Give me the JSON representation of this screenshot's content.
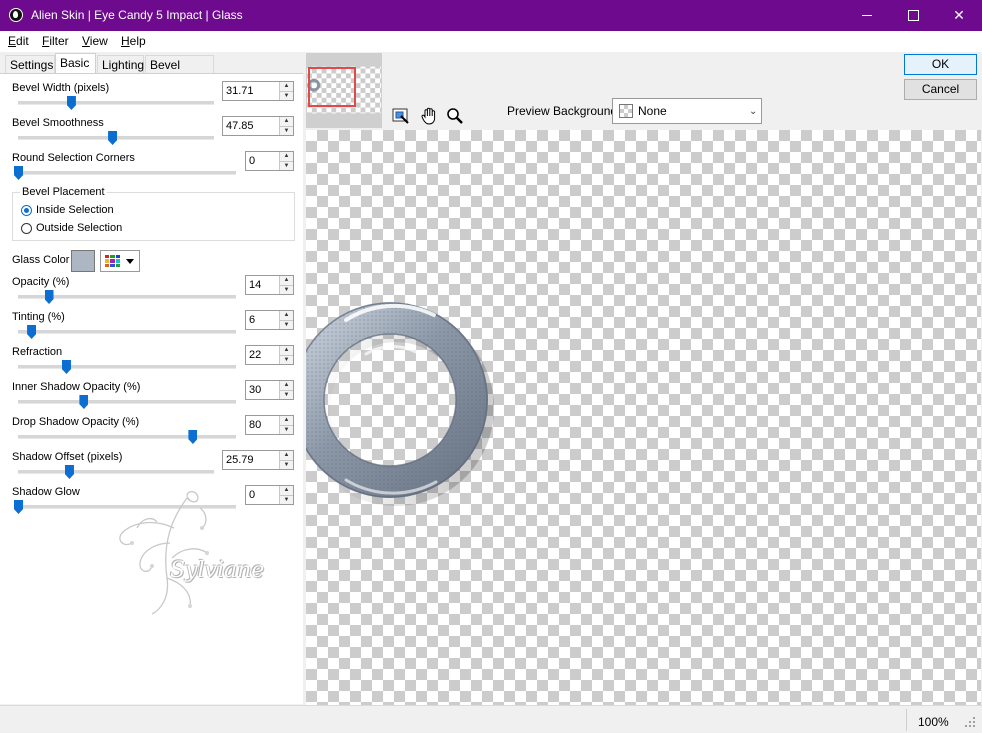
{
  "window": {
    "title": "Alien Skin | Eye Candy 5 Impact | Glass",
    "title_bar_color": "#6d0a8e"
  },
  "menu": {
    "items": [
      "Edit",
      "Filter",
      "View",
      "Help"
    ]
  },
  "tabs": {
    "items": [
      "Settings",
      "Basic",
      "Lighting",
      "Bevel Profile"
    ],
    "active": "Basic"
  },
  "controls": {
    "bevel_width": {
      "label": "Bevel Width (pixels)",
      "value": "31.71",
      "level": 0.27
    },
    "bevel_smoothness": {
      "label": "Bevel Smoothness",
      "value": "47.85",
      "level": 0.48
    },
    "round_corners": {
      "label": "Round Selection Corners",
      "value": "0",
      "level": 0.0
    },
    "bevel_placement": {
      "title": "Bevel Placement",
      "options": [
        "Inside Selection",
        "Outside Selection"
      ],
      "selected": "Inside Selection"
    },
    "glass_color": {
      "label": "Glass Color",
      "swatch": "#adb7c4"
    },
    "opacity": {
      "label": "Opacity (%)",
      "value": "14",
      "level": 0.14
    },
    "tinting": {
      "label": "Tinting (%)",
      "value": "6",
      "level": 0.06
    },
    "refraction": {
      "label": "Refraction",
      "value": "22",
      "level": 0.22
    },
    "inner_shadow_opacity": {
      "label": "Inner Shadow Opacity (%)",
      "value": "30",
      "level": 0.3
    },
    "drop_shadow_opacity": {
      "label": "Drop Shadow Opacity (%)",
      "value": "80",
      "level": 0.8
    },
    "shadow_offset": {
      "label": "Shadow Offset (pixels)",
      "value": "25.79",
      "level": 0.26
    },
    "shadow_glow": {
      "label": "Shadow Glow",
      "value": "0",
      "level": 0.0
    }
  },
  "buttons": {
    "ok": "OK",
    "cancel": "Cancel"
  },
  "preview_background": {
    "label": "Preview Background:",
    "value": "None"
  },
  "watermark": "Sylviane",
  "status": {
    "zoom": "100%"
  },
  "accent_color": "#0b6ed0",
  "icons": [
    "app-icon",
    "minimize-icon",
    "maximize-icon",
    "close-icon",
    "navigator-icon",
    "hand-icon",
    "zoom-icon",
    "chevron-down-icon",
    "resize-grip-icon"
  ]
}
